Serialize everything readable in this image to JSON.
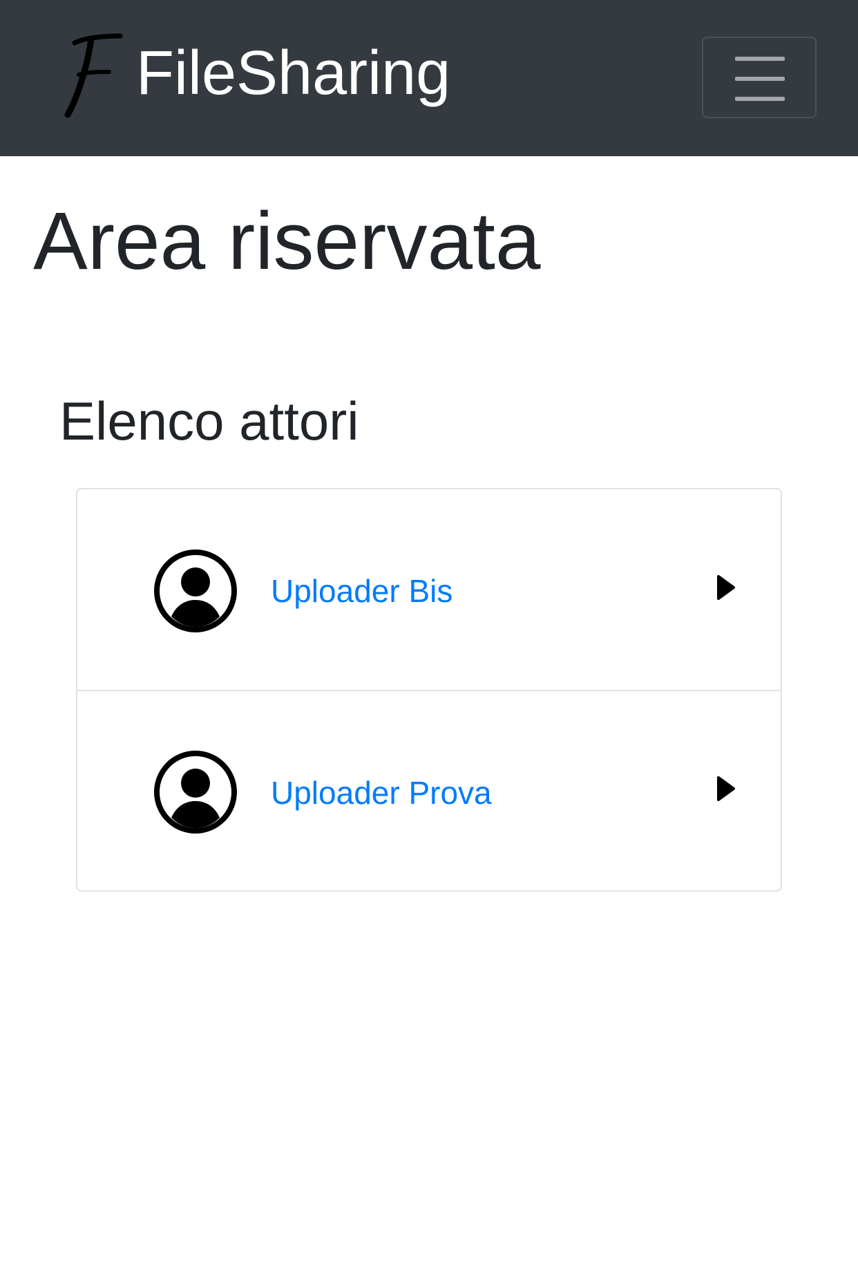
{
  "navbar": {
    "brand_name": "FileSharing",
    "logo_icon": "script-f-logo-icon",
    "toggler_icon": "hamburger-menu-icon"
  },
  "page": {
    "title": "Area riservata"
  },
  "section": {
    "title": "Elenco attori"
  },
  "actors": [
    {
      "name": "Uploader Bis",
      "icon": "user-circle-icon",
      "action_icon": "caret-right-icon"
    },
    {
      "name": "Uploader Prova",
      "icon": "user-circle-icon",
      "action_icon": "caret-right-icon"
    }
  ],
  "colors": {
    "navbar_bg": "#343a40",
    "link": "#007bff",
    "text": "#212529",
    "border": "#dee2e6"
  }
}
